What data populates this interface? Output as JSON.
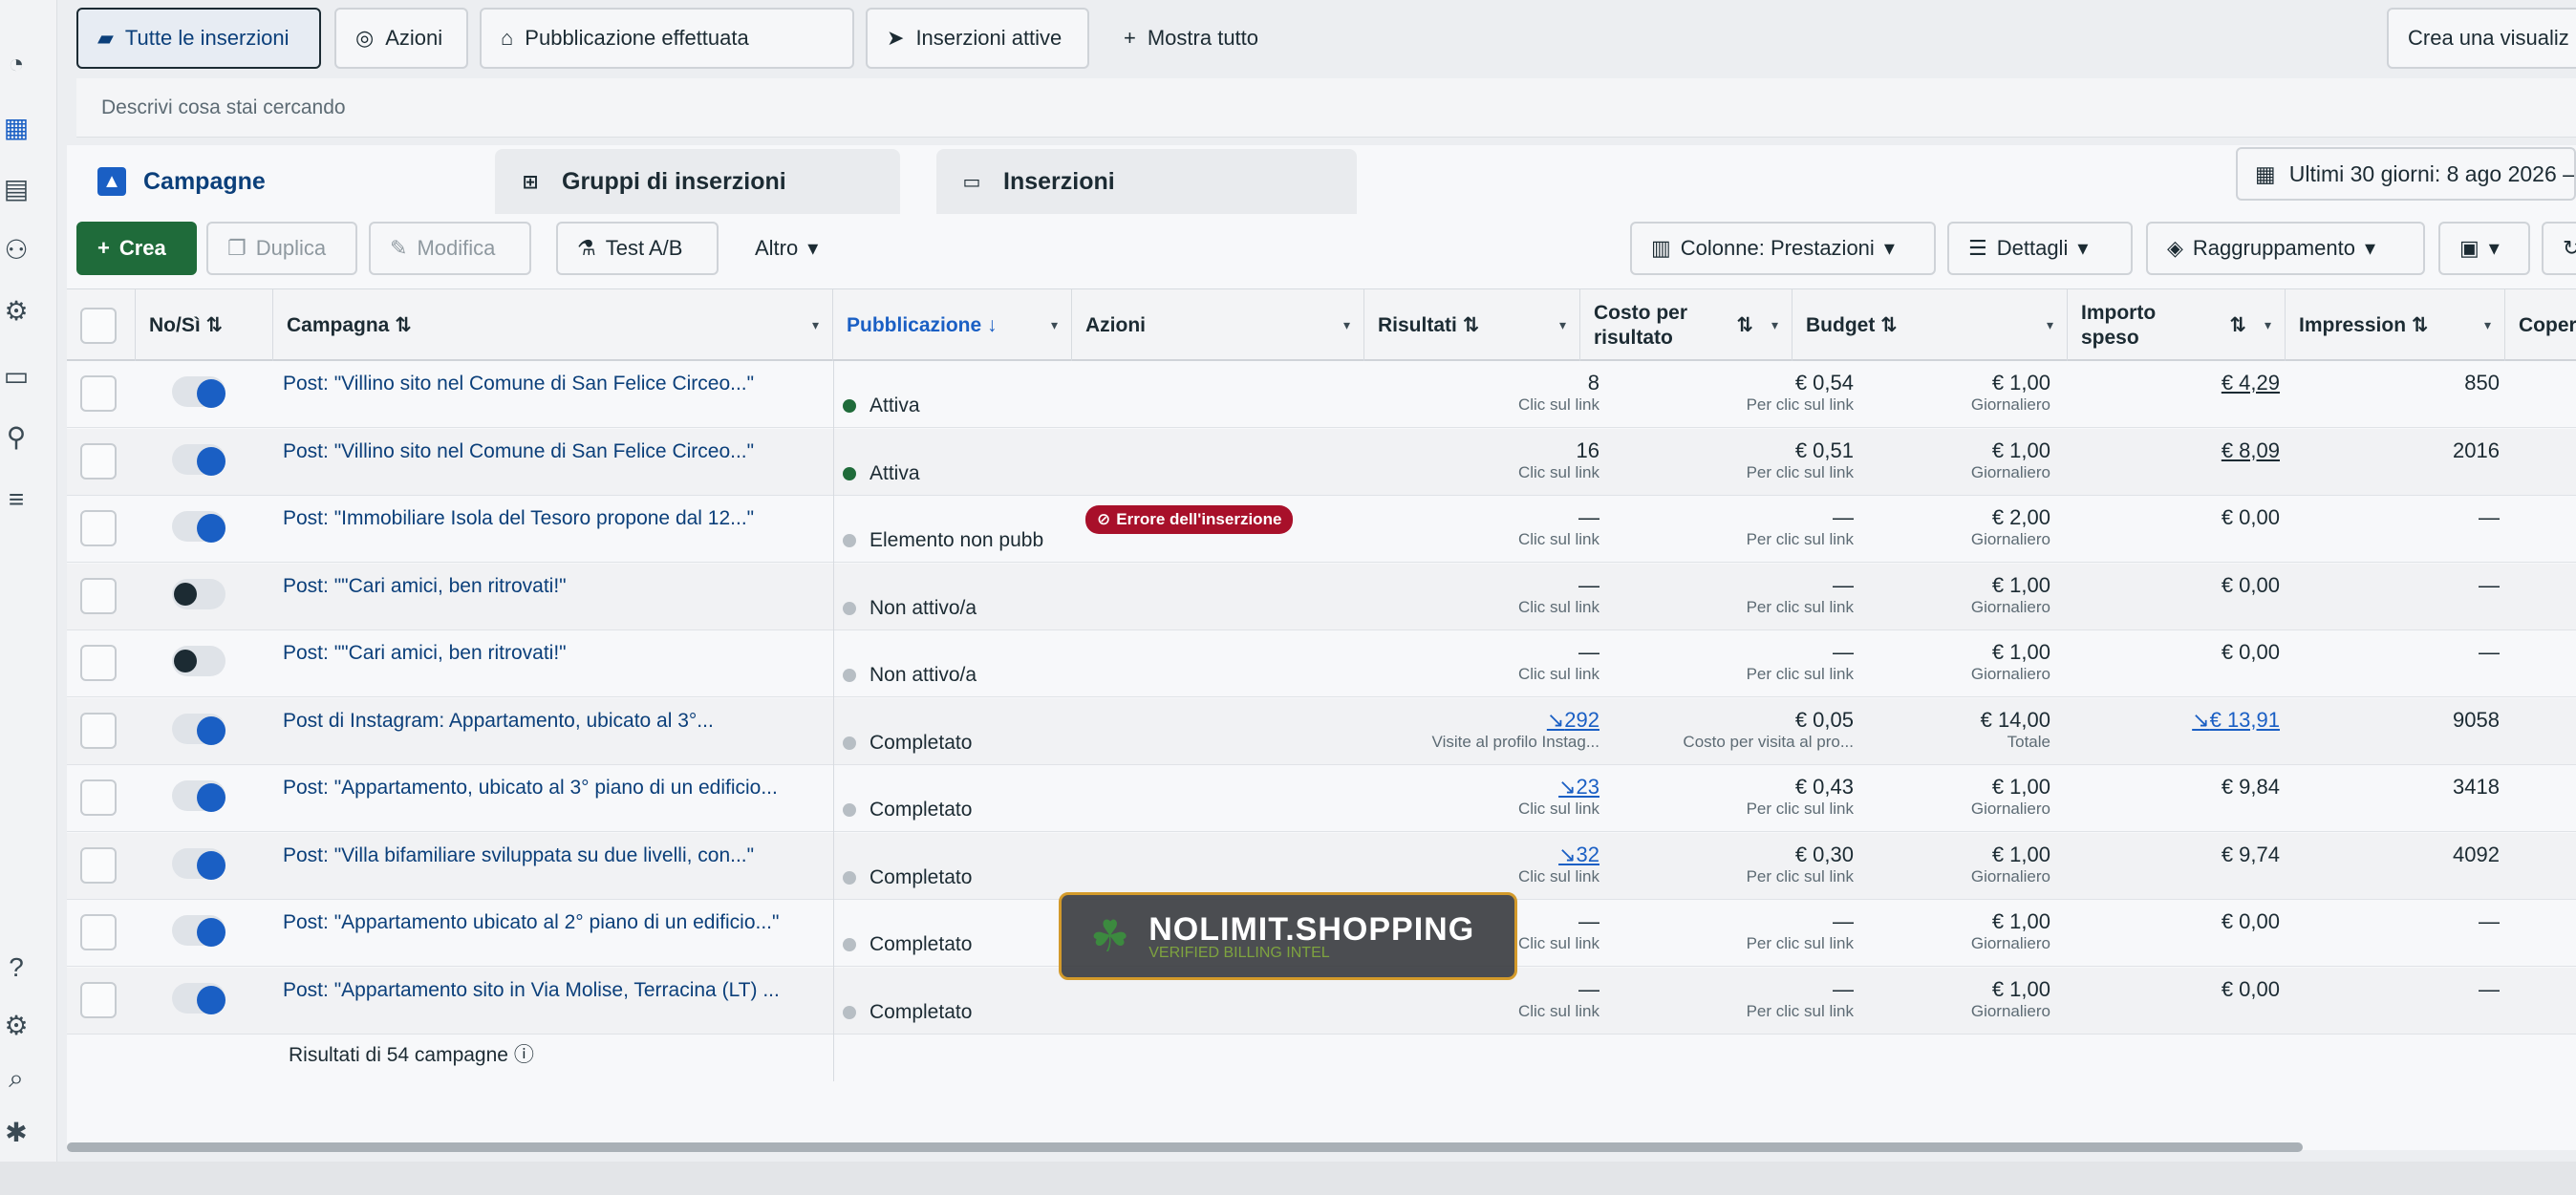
{
  "topbar": {
    "filters": [
      {
        "label": "Tutte le inserzioni",
        "icon": "folder-icon",
        "selected": true
      },
      {
        "label": "Azioni",
        "icon": "action-icon",
        "selected": false
      },
      {
        "label": "Pubblicazione effettuata",
        "icon": "inbox-icon",
        "selected": false
      },
      {
        "label": "Inserzioni attive",
        "icon": "send-icon",
        "selected": false
      },
      {
        "label": "Mostra tutto",
        "icon": "plus-icon",
        "selected": false
      }
    ],
    "create_view": "Crea una visualiz"
  },
  "search": {
    "placeholder": "Descrivi cosa stai cercando"
  },
  "tabs": [
    {
      "label": "Campagne",
      "icon": "campaign-icon",
      "active": true
    },
    {
      "label": "Gruppi di inserzioni",
      "icon": "grid-icon",
      "active": false
    },
    {
      "label": "Inserzioni",
      "icon": "ad-icon",
      "active": false
    }
  ],
  "date_range": "Ultimi 30 giorni: 8 ago 2026 –",
  "toolbar": {
    "create": "Crea",
    "duplicate": "Duplica",
    "edit": "Modifica",
    "abtest": "Test A/B",
    "more": "Altro",
    "columns": "Colonne: Prestazioni",
    "details": "Dettagli",
    "grouping": "Raggruppamento"
  },
  "columns": {
    "onoff": "No/Sì",
    "campaign": "Campagna",
    "delivery": "Pubblicazione",
    "actions": "Azioni",
    "results": "Risultati",
    "cost": "Costo per risultato",
    "budget": "Budget",
    "spent": "Importo speso",
    "impressions": "Impression",
    "reach": "Copertura"
  },
  "rows": [
    {
      "on": true,
      "campaign": "Post: \"Villino sito nel Comune di San Felice Circeo...\"",
      "status": "Attiva",
      "status_color": "#1f6b3a",
      "error": "",
      "results": "8",
      "results_sub": "Clic sul link",
      "results_trend": false,
      "cost": "€ 0,54",
      "cost_sub": "Per clic sul link",
      "budget": "€ 1,00",
      "budget_sub": "Giornaliero",
      "spent": "€ 4,29",
      "spent_link": "strike",
      "impressions": "850"
    },
    {
      "on": true,
      "campaign": "Post: \"Villino sito nel Comune di San Felice Circeo...\"",
      "status": "Attiva",
      "status_color": "#1f6b3a",
      "error": "",
      "results": "16",
      "results_sub": "Clic sul link",
      "results_trend": false,
      "cost": "€ 0,51",
      "cost_sub": "Per clic sul link",
      "budget": "€ 1,00",
      "budget_sub": "Giornaliero",
      "spent": "€ 8,09",
      "spent_link": "strike",
      "impressions": "2016"
    },
    {
      "on": true,
      "campaign": "Post: \"Immobiliare Isola del Tesoro propone dal 12...\"",
      "status": "Elemento non pubb",
      "status_color": "#b7bec4",
      "error": "Errore dell'inserzione",
      "results": "—",
      "results_sub": "Clic sul link",
      "results_trend": false,
      "cost": "—",
      "cost_sub": "Per clic sul link",
      "budget": "€ 2,00",
      "budget_sub": "Giornaliero",
      "spent": "€ 0,00",
      "spent_link": "",
      "impressions": "—"
    },
    {
      "on": false,
      "campaign": "Post: \"\"Cari amici, ben ritrovati!\"",
      "status": "Non attivo/a",
      "status_color": "#b7bec4",
      "error": "",
      "results": "—",
      "results_sub": "Clic sul link",
      "results_trend": false,
      "cost": "—",
      "cost_sub": "Per clic sul link",
      "budget": "€ 1,00",
      "budget_sub": "Giornaliero",
      "spent": "€ 0,00",
      "spent_link": "",
      "impressions": "—"
    },
    {
      "on": false,
      "campaign": "Post: \"\"Cari amici, ben ritrovati!\"",
      "status": "Non attivo/a",
      "status_color": "#b7bec4",
      "error": "",
      "results": "—",
      "results_sub": "Clic sul link",
      "results_trend": false,
      "cost": "—",
      "cost_sub": "Per clic sul link",
      "budget": "€ 1,00",
      "budget_sub": "Giornaliero",
      "spent": "€ 0,00",
      "spent_link": "",
      "impressions": "—"
    },
    {
      "on": true,
      "campaign": "Post di Instagram: Appartamento, ubicato al 3°...",
      "status": "Completato",
      "status_color": "#b7bec4",
      "error": "",
      "results": "292",
      "results_sub": "Visite al profilo Instag...",
      "results_trend": true,
      "cost": "€ 0,05",
      "cost_sub": "Costo per visita al pro...",
      "budget": "€ 14,00",
      "budget_sub": "Totale",
      "spent": "€ 13,91",
      "spent_link": "link",
      "impressions": "9058"
    },
    {
      "on": true,
      "campaign": "Post: \"Appartamento, ubicato al 3° piano di un edificio...",
      "status": "Completato",
      "status_color": "#b7bec4",
      "error": "",
      "results": "23",
      "results_sub": "Clic sul link",
      "results_trend": true,
      "cost": "€ 0,43",
      "cost_sub": "Per clic sul link",
      "budget": "€ 1,00",
      "budget_sub": "Giornaliero",
      "spent": "€ 9,84",
      "spent_link": "",
      "impressions": "3418"
    },
    {
      "on": true,
      "campaign": "Post: \"Villa bifamiliare sviluppata su due livelli, con...\"",
      "status": "Completato",
      "status_color": "#b7bec4",
      "error": "",
      "results": "32",
      "results_sub": "Clic sul link",
      "results_trend": true,
      "cost": "€ 0,30",
      "cost_sub": "Per clic sul link",
      "budget": "€ 1,00",
      "budget_sub": "Giornaliero",
      "spent": "€ 9,74",
      "spent_link": "",
      "impressions": "4092"
    },
    {
      "on": true,
      "campaign": "Post: \"Appartamento ubicato al 2° piano di un edificio...\"",
      "status": "Completato",
      "status_color": "#b7bec4",
      "error": "",
      "results": "—",
      "results_sub": "Clic sul link",
      "results_trend": false,
      "cost": "—",
      "cost_sub": "Per clic sul link",
      "budget": "€ 1,00",
      "budget_sub": "Giornaliero",
      "spent": "€ 0,00",
      "spent_link": "",
      "impressions": "—"
    },
    {
      "on": true,
      "campaign": "Post: \"Appartamento sito in Via Molise, Terracina (LT) ...",
      "status": "Completato",
      "status_color": "#b7bec4",
      "error": "",
      "results": "—",
      "results_sub": "Clic sul link",
      "results_trend": false,
      "cost": "—",
      "cost_sub": "Per clic sul link",
      "budget": "€ 1,00",
      "budget_sub": "Giornaliero",
      "spent": "€ 0,00",
      "spent_link": "",
      "impressions": "—"
    }
  ],
  "footer": {
    "summary": "Risultati di 54 campagne"
  },
  "watermark": {
    "title": "NOLIMIT.SHOPPING",
    "subtitle": "VERIFIED BILLING INTEL"
  },
  "colors": {
    "accent": "#1a5fc4",
    "create": "#1f6b3a",
    "error": "#a8102a"
  }
}
